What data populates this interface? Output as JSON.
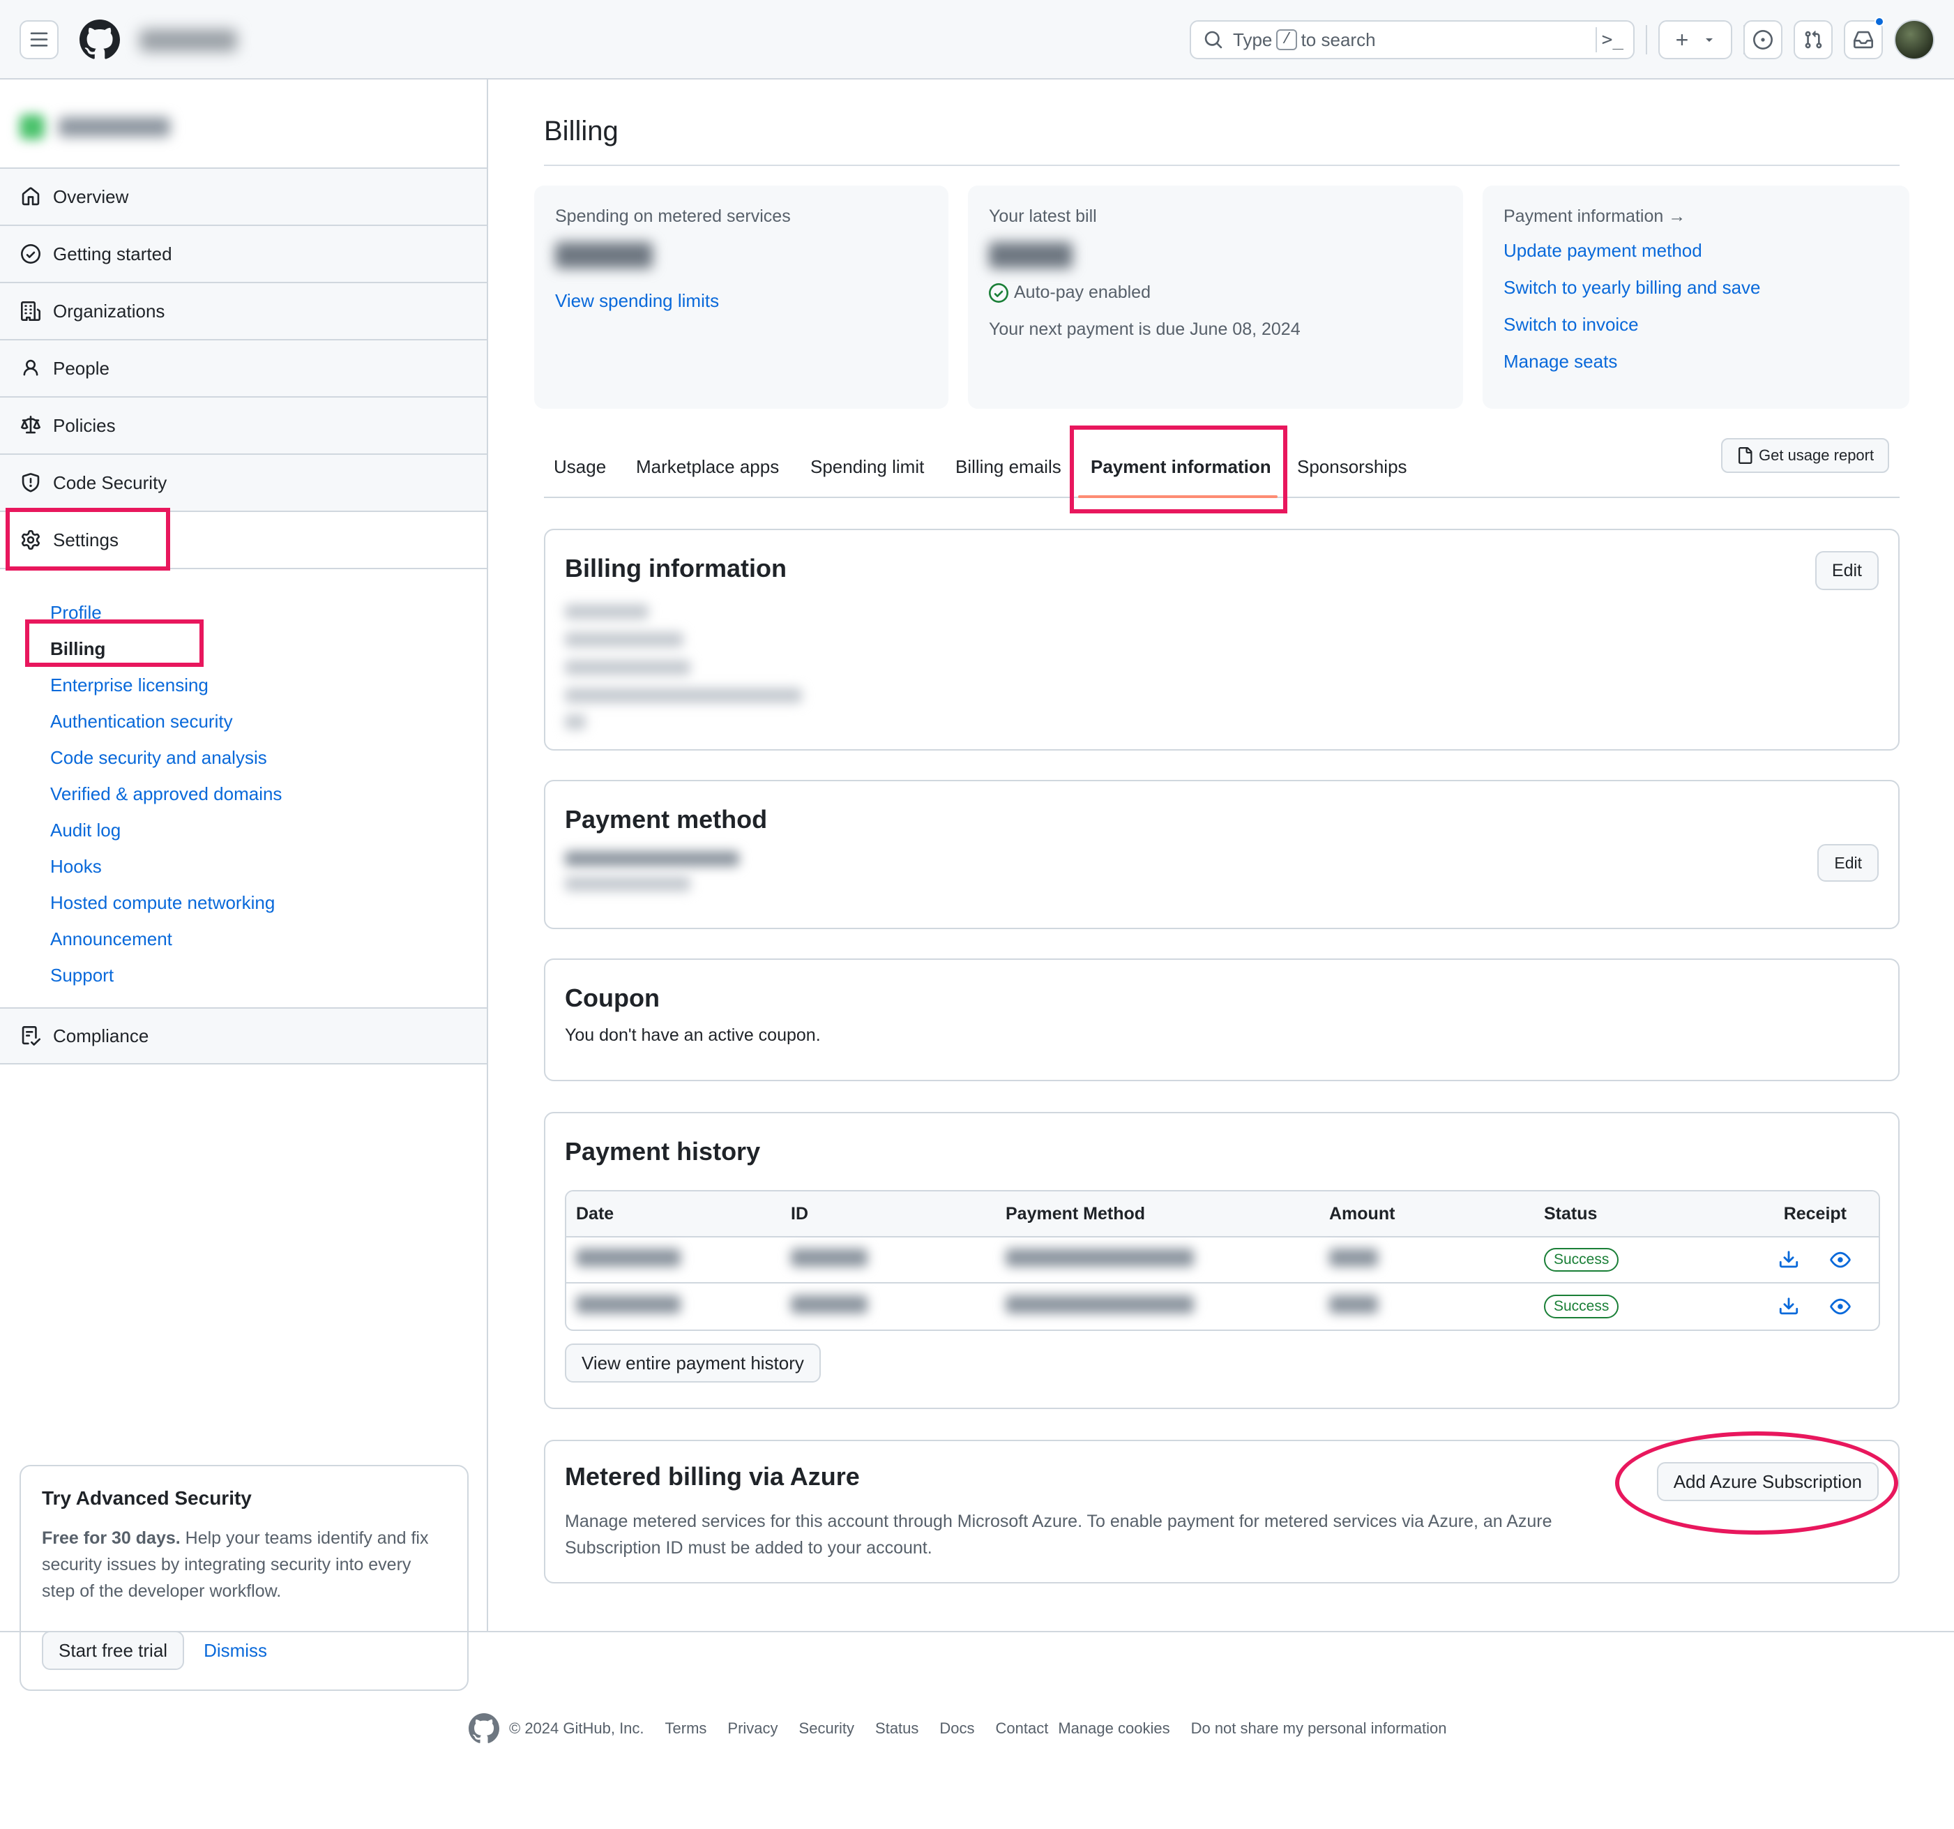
{
  "header": {
    "menu_icon": "hamburger-icon",
    "logo": "github-logo",
    "search": {
      "prefix": "Type",
      "key": "/",
      "suffix": "to search"
    },
    "icons": [
      "command-palette-icon",
      "plus-icon",
      "triangle-down-icon",
      "issue-opened-icon",
      "git-pull-request-icon",
      "inbox-icon"
    ],
    "accent": "#0969da"
  },
  "sidebar": {
    "items": [
      {
        "label": "Overview",
        "icon": "home-icon"
      },
      {
        "label": "Getting started",
        "icon": "check-circle-icon"
      },
      {
        "label": "Organizations",
        "icon": "organization-icon"
      },
      {
        "label": "People",
        "icon": "person-icon"
      },
      {
        "label": "Policies",
        "icon": "law-icon"
      },
      {
        "label": "Code Security",
        "icon": "shield-icon"
      },
      {
        "label": "Settings",
        "icon": "gear-icon"
      }
    ],
    "settings_sub": [
      "Profile",
      "Billing",
      "Enterprise licensing",
      "Authentication security",
      "Code security and analysis",
      "Verified & approved domains",
      "Audit log",
      "Hooks",
      "Hosted compute networking",
      "Announcement",
      "Support"
    ],
    "compliance": {
      "label": "Compliance",
      "icon": "checklist-icon"
    },
    "promo": {
      "title": "Try Advanced Security",
      "bold": "Free for 30 days.",
      "text": " Help your teams identify and fix security issues by integrating security into every step of the developer workflow.",
      "start": "Start free trial",
      "dismiss": "Dismiss"
    }
  },
  "main": {
    "title": "Billing",
    "spending": {
      "label": "Spending on metered services",
      "link": "View spending limits"
    },
    "latest_bill": {
      "label": "Your latest bill",
      "autopay": "Auto-pay enabled",
      "next_payment": "Your next payment is due June 08, 2024"
    },
    "payment_info": {
      "label": "Payment information →",
      "links": [
        "Update payment method",
        "Switch to yearly billing and save",
        "Switch to invoice",
        "Manage seats"
      ]
    },
    "tabs": [
      "Usage",
      "Marketplace apps",
      "Spending limit",
      "Billing emails",
      "Payment information",
      "Sponsorships"
    ],
    "usage_report": "Get usage report",
    "billing_information": {
      "title": "Billing information",
      "edit": "Edit"
    },
    "payment_method": {
      "title": "Payment method",
      "edit": "Edit"
    },
    "coupon": {
      "title": "Coupon",
      "text": "You don't have an active coupon."
    },
    "payment_history": {
      "title": "Payment history",
      "columns": [
        "Date",
        "ID",
        "Payment Method",
        "Amount",
        "Status",
        "Receipt"
      ],
      "rows": [
        {
          "status": "Success"
        },
        {
          "status": "Success"
        }
      ],
      "view_all": "View entire payment history"
    },
    "azure": {
      "title": "Metered billing via Azure",
      "text": "Manage metered services for this account through Microsoft Azure. To enable payment for metered services via Azure, an Azure Subscription ID must be added to your account.",
      "button": "Add Azure Subscription"
    }
  },
  "footer": {
    "copyright": "© 2024 GitHub, Inc.",
    "links": [
      "Terms",
      "Privacy",
      "Security",
      "Status",
      "Docs",
      "Contact",
      "Manage cookies",
      "Do not share my personal information"
    ]
  },
  "colors": {
    "highlight": "#e8175d",
    "success": "#1a7f37",
    "tab_underline": "#fd8c73"
  }
}
